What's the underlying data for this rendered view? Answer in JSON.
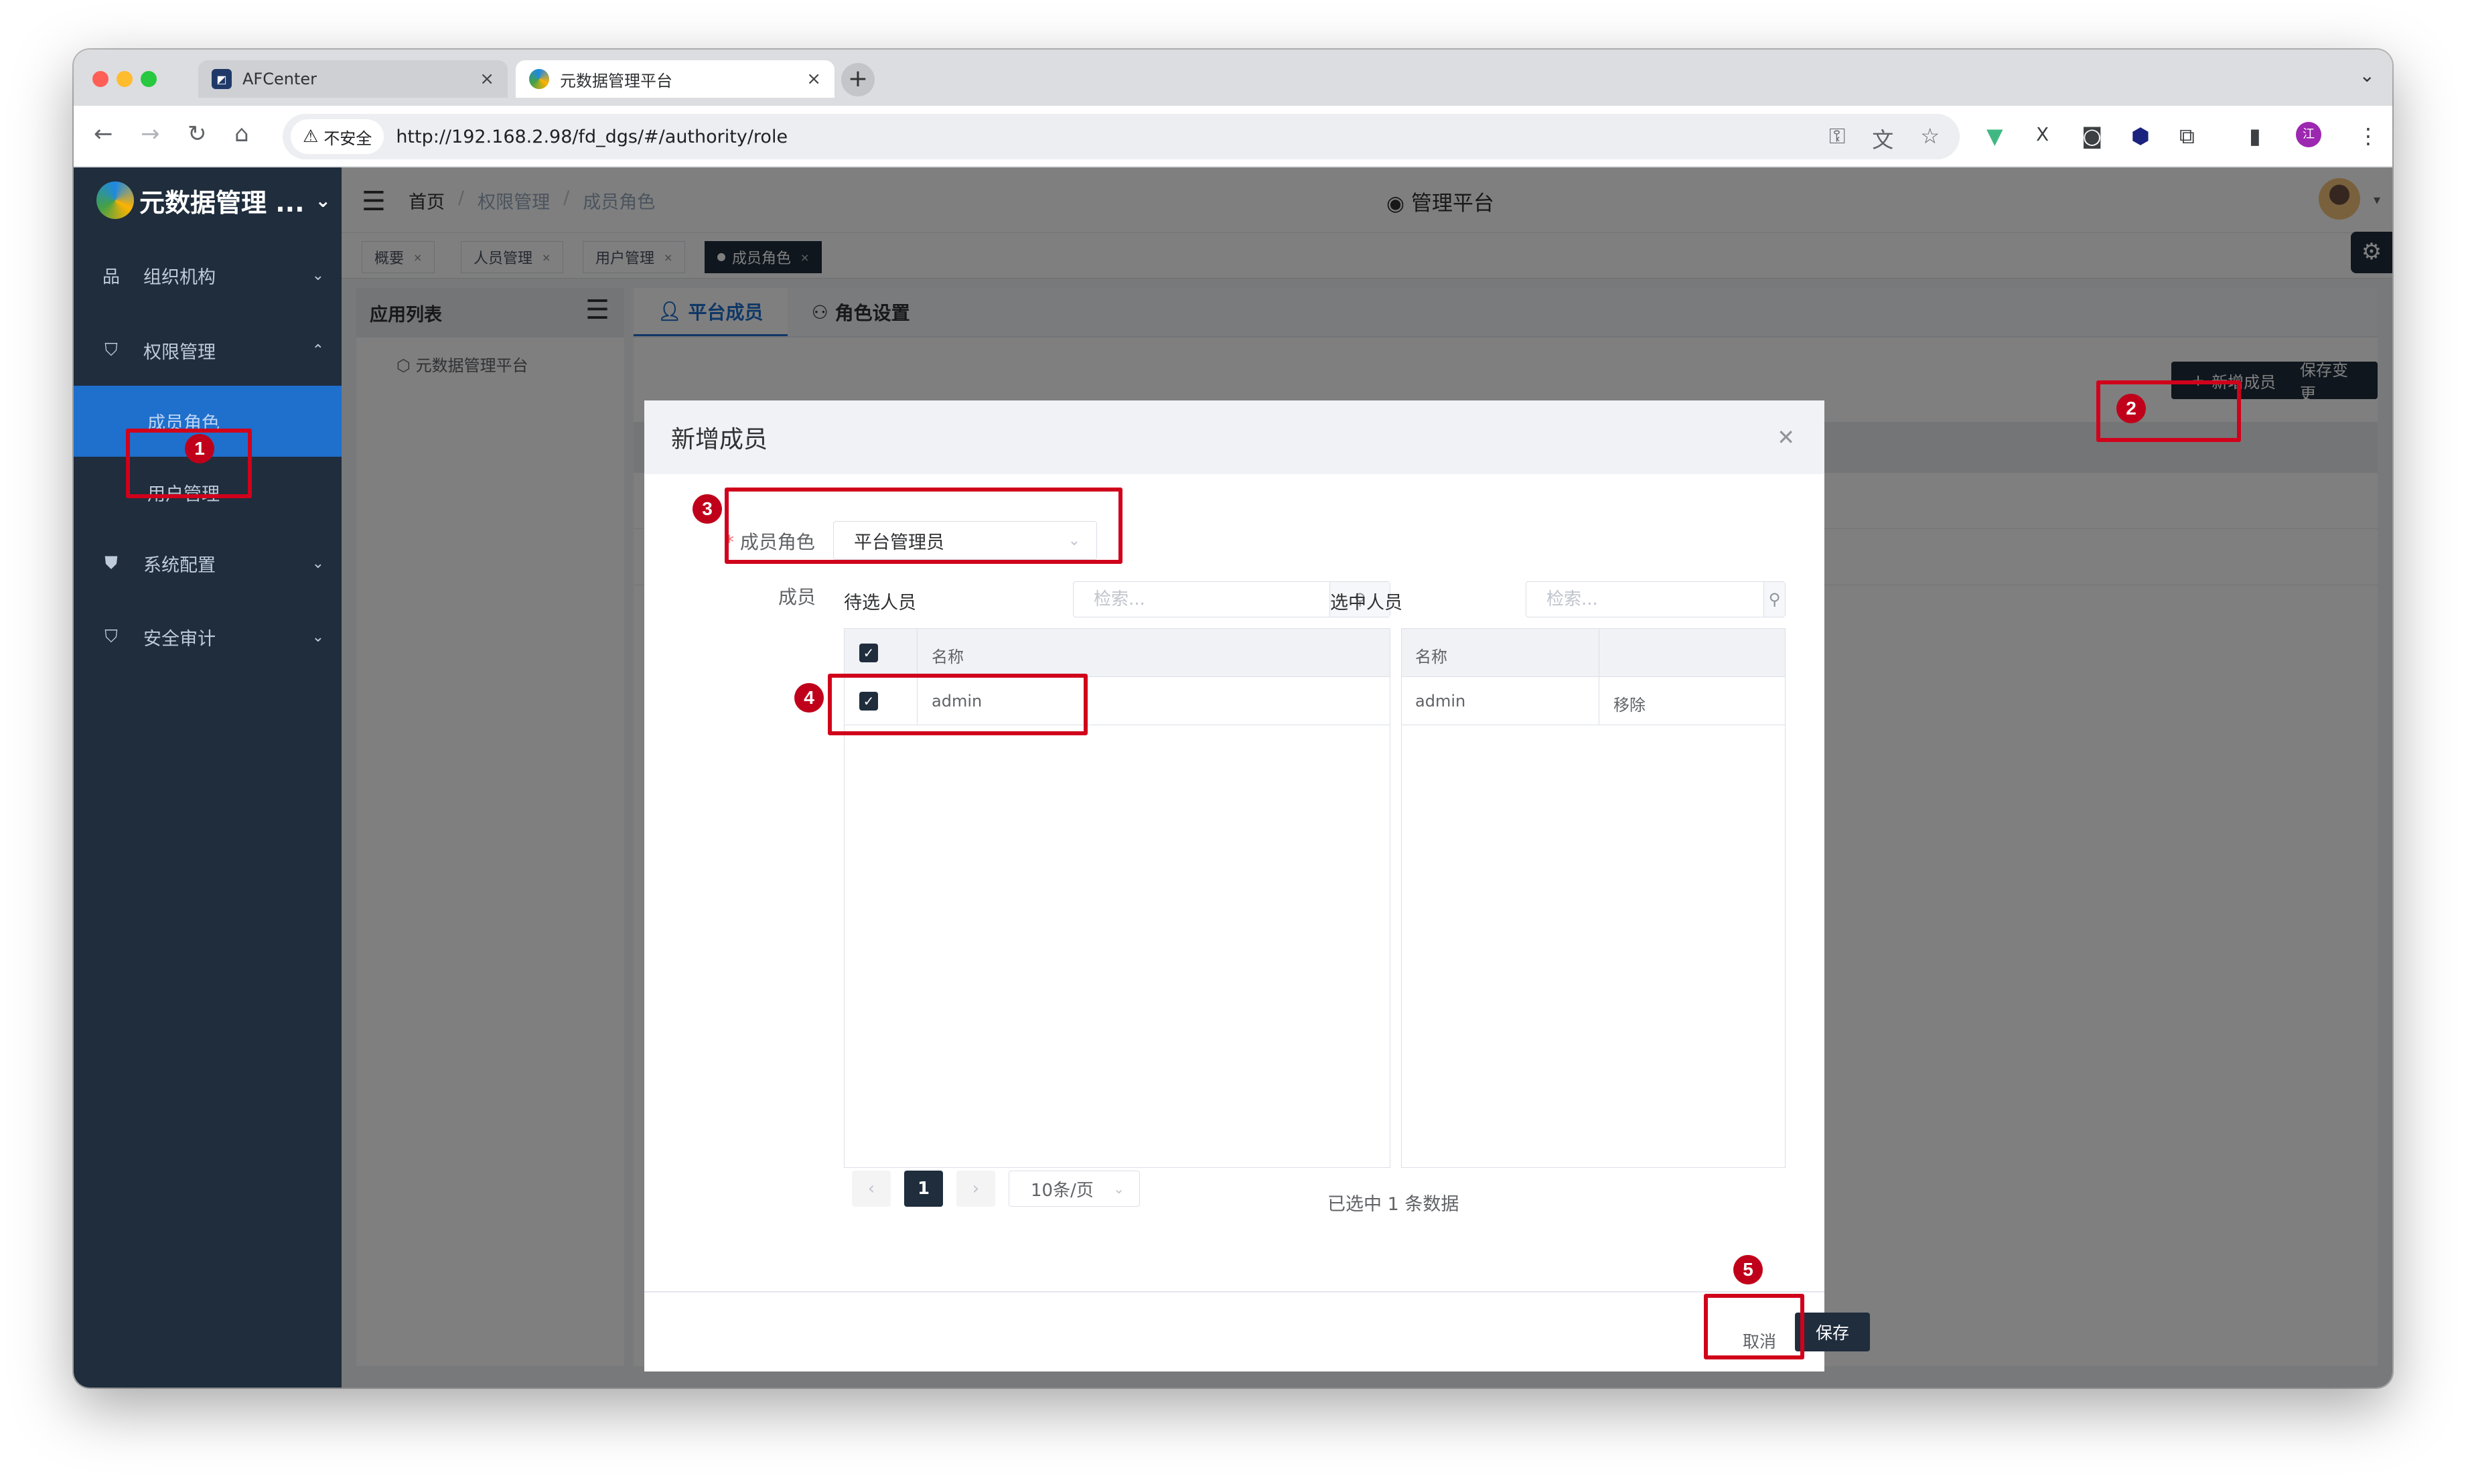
{
  "browser": {
    "tabs": [
      {
        "label": "AFCenter",
        "active": false
      },
      {
        "label": "元数据管理平台",
        "active": true
      }
    ],
    "insecure_label": "不安全",
    "url": "http://192.168.2.98/fd_dgs/#/authority/role"
  },
  "app": {
    "brand": "元数据管理 ...",
    "sidebar": {
      "items": [
        {
          "label": "组织机构",
          "icon": "org-icon"
        },
        {
          "label": "权限管理",
          "icon": "shield-icon"
        },
        {
          "label": "成员角色",
          "active": true
        },
        {
          "label": "用户管理"
        },
        {
          "label": "系统配置",
          "icon": "config-shield-icon"
        },
        {
          "label": "安全审计",
          "icon": "audit-shield-icon"
        }
      ]
    },
    "breadcrumb": [
      "首页",
      "权限管理",
      "成员角色"
    ],
    "center_title": "管理平台",
    "tags": [
      "概要",
      "人员管理",
      "用户管理",
      "成员角色"
    ],
    "app_list": {
      "title": "应用列表",
      "item": "元数据管理平台"
    },
    "main_tabs": [
      "平台成员",
      "角色设置"
    ],
    "actions": {
      "add_member": "新增成员",
      "save_changes": "保存变更"
    }
  },
  "dialog": {
    "title": "新增成员",
    "role_label": "成员角色",
    "role_value": "平台管理员",
    "member_label": "成员",
    "left_pane": {
      "title": "待选人员",
      "search_placeholder": "检索...",
      "column": "名称",
      "rows": [
        "admin"
      ]
    },
    "right_pane": {
      "title": "选中人员",
      "search_placeholder": "检索...",
      "column": "名称",
      "rows": [
        {
          "name": "admin",
          "action": "移除"
        }
      ]
    },
    "pager": {
      "current_page": "1",
      "page_size": "10条/页"
    },
    "selected_count_text": "已选中 1 条数据",
    "cancel_label": "取消",
    "save_label": "保存"
  },
  "callouts": [
    "1",
    "2",
    "3",
    "4",
    "5"
  ],
  "colors": {
    "accent": "#1f6fcc",
    "sidebar": "#1f2d3d",
    "callout": "#d0021b"
  }
}
